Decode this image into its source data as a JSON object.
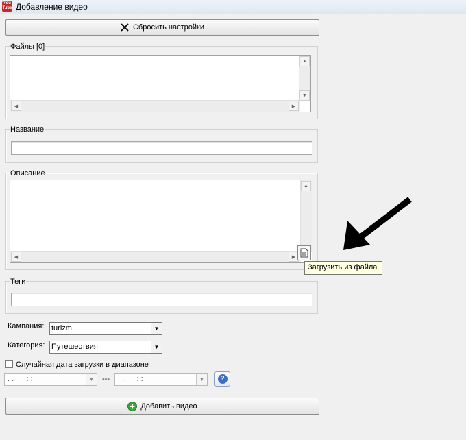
{
  "window": {
    "title": "Добавление видео",
    "app_icon_text": "You Tube"
  },
  "toolbar": {
    "reset_label": "Сбросить настройки",
    "reset_icon": "close-icon"
  },
  "files_group": {
    "legend": "Файлы [0]"
  },
  "name_group": {
    "legend": "Название",
    "value": ""
  },
  "description_group": {
    "legend": "Описание",
    "value": ""
  },
  "tooltip": {
    "text": "Загрузить из файла"
  },
  "tags_group": {
    "legend": "Теги",
    "value": ""
  },
  "campaign": {
    "label": "Кампания:",
    "selected": "turizm"
  },
  "category": {
    "label": "Категория:",
    "selected": "Путешествия"
  },
  "random_date": {
    "label": "Случайная дата загрузки в диапазоне",
    "checked": false
  },
  "date_range": {
    "from": ". .      : :",
    "separator": "---",
    "to": ". .      : :"
  },
  "help_button": {
    "icon": "question-icon",
    "glyph": "?"
  },
  "add_button": {
    "label": "Добавить видео",
    "icon": "plus-circle-icon"
  },
  "colors": {
    "accent_blue": "#3d6fc4",
    "tooltip_bg": "#ffffe1",
    "add_icon_green": "#3aa63a"
  }
}
